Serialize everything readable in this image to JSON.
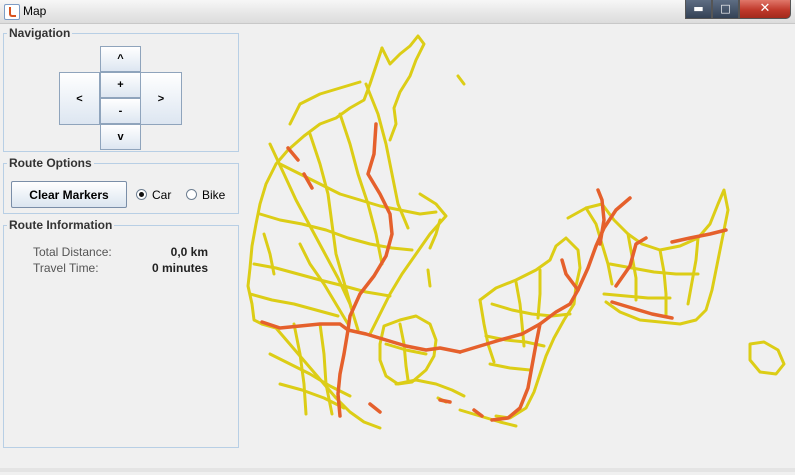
{
  "window": {
    "title": "Map",
    "minimize_glyph": "▬",
    "maximize_glyph": "□",
    "close_glyph": "✕"
  },
  "navigation": {
    "legend": "Navigation",
    "up": "^",
    "down": "v",
    "left": "<",
    "right": ">",
    "zoom_in": "+",
    "zoom_out": "-"
  },
  "route_options": {
    "legend": "Route Options",
    "clear_button": "Clear Markers",
    "options": [
      {
        "label": "Car",
        "selected": true
      },
      {
        "label": "Bike",
        "selected": false
      }
    ]
  },
  "route_info": {
    "legend": "Route Information",
    "rows": [
      {
        "label": "Total Distance:",
        "value": "0,0 km"
      },
      {
        "label": "Travel Time:",
        "value": "0 minutes"
      }
    ]
  },
  "map": {
    "region": "Denmark road network",
    "minor_road_color": "#dccd16",
    "major_road_color": "#e5602c"
  }
}
